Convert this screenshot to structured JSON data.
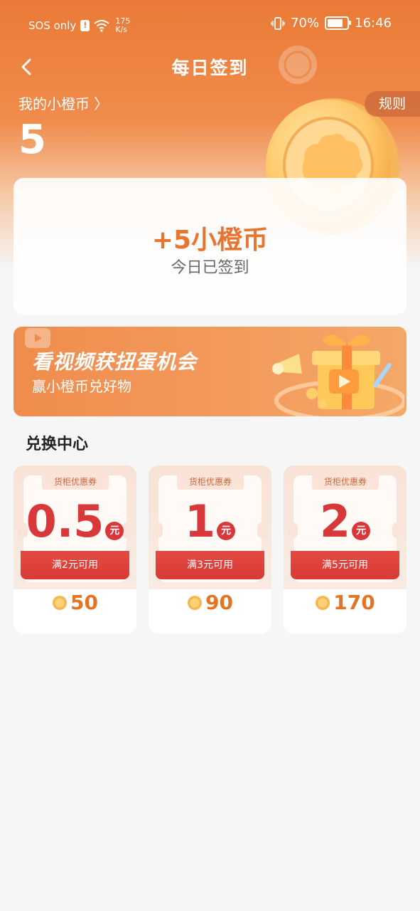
{
  "status_bar": {
    "carrier": "SOS only",
    "alert_glyph": "!",
    "wifi_icon": "wifi-icon",
    "net_speed_value": "175",
    "net_speed_unit": "K/s",
    "vibrate_icon": "vibrate-icon",
    "battery": "70%",
    "battery_level": 0.7,
    "time": "16:46"
  },
  "nav": {
    "title": "每日签到",
    "back_icon": "back-arrow-icon",
    "rules_label": "规则"
  },
  "wallet": {
    "link_label": "我的小橙币 〉",
    "coin_count": "5"
  },
  "sign_in": {
    "reward": "+5小橙币",
    "status": "今日已签到"
  },
  "banner": {
    "title": "看视频获扭蛋机会",
    "subtitle": "赢小橙币兑好物"
  },
  "exchange": {
    "title": "兑换中心",
    "vouchers": [
      {
        "tag": "货柜优惠券",
        "amount": "0.5",
        "unit": "元",
        "condition": "满2元可用",
        "price": "50"
      },
      {
        "tag": "货柜优惠券",
        "amount": "1",
        "unit": "元",
        "condition": "满3元可用",
        "price": "90"
      },
      {
        "tag": "货柜优惠券",
        "amount": "2",
        "unit": "元",
        "condition": "满5元可用",
        "price": "170"
      }
    ]
  },
  "colors": {
    "brand_orange": "#ea7a36",
    "accent_red": "#d8383a",
    "price_orange": "#e57324"
  }
}
